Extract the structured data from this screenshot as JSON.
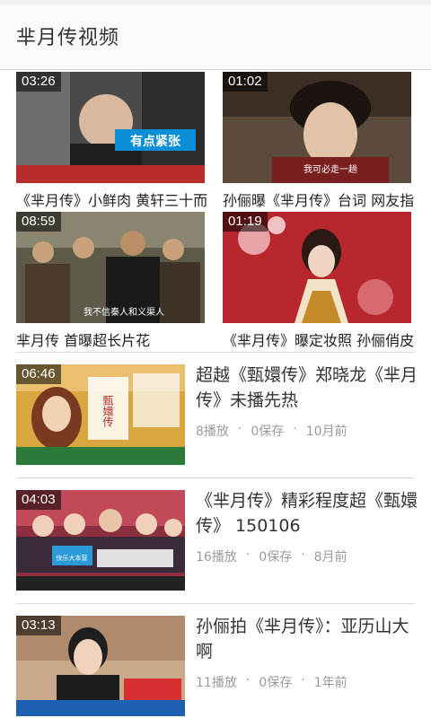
{
  "header": {
    "title": "芈月传视频"
  },
  "grid": [
    {
      "duration": "03:26",
      "title": "《芈月传》小鲜肉 黄轩三十而"
    },
    {
      "duration": "01:02",
      "title": "孙俪曝《芈月传》台词 网友指"
    },
    {
      "duration": "08:59",
      "title": "芈月传 首曝超长片花"
    },
    {
      "duration": "01:19",
      "title": "《芈月传》曝定妆照 孙俪俏皮"
    }
  ],
  "list": [
    {
      "duration": "06:46",
      "title": "超越《甄嬛传》郑晓龙《芈月传》未播先热",
      "plays": "8播放",
      "saves": "0保存",
      "time": "10月前"
    },
    {
      "duration": "04:03",
      "title": "《芈月传》精彩程度超《甄嬛传》 150106",
      "plays": "16播放",
      "saves": "0保存",
      "time": "8月前"
    },
    {
      "duration": "03:13",
      "title": "孙俪拍《芈月传》：亚历山大啊",
      "plays": "11播放",
      "saves": "0保存",
      "time": "1年前"
    }
  ],
  "meta_separator": "·",
  "thumb_captions": {
    "g0_banner": "有点紧张",
    "g2_sub": "我不信秦人和义渠人",
    "g1_sub": "我可必走一趟",
    "l0_overlay": "甄嬛传",
    "l1_logo": "快乐大本营"
  },
  "colors": {
    "accent": "#333333",
    "meta": "#9a9a9a",
    "divider": "#dcdcdc"
  }
}
